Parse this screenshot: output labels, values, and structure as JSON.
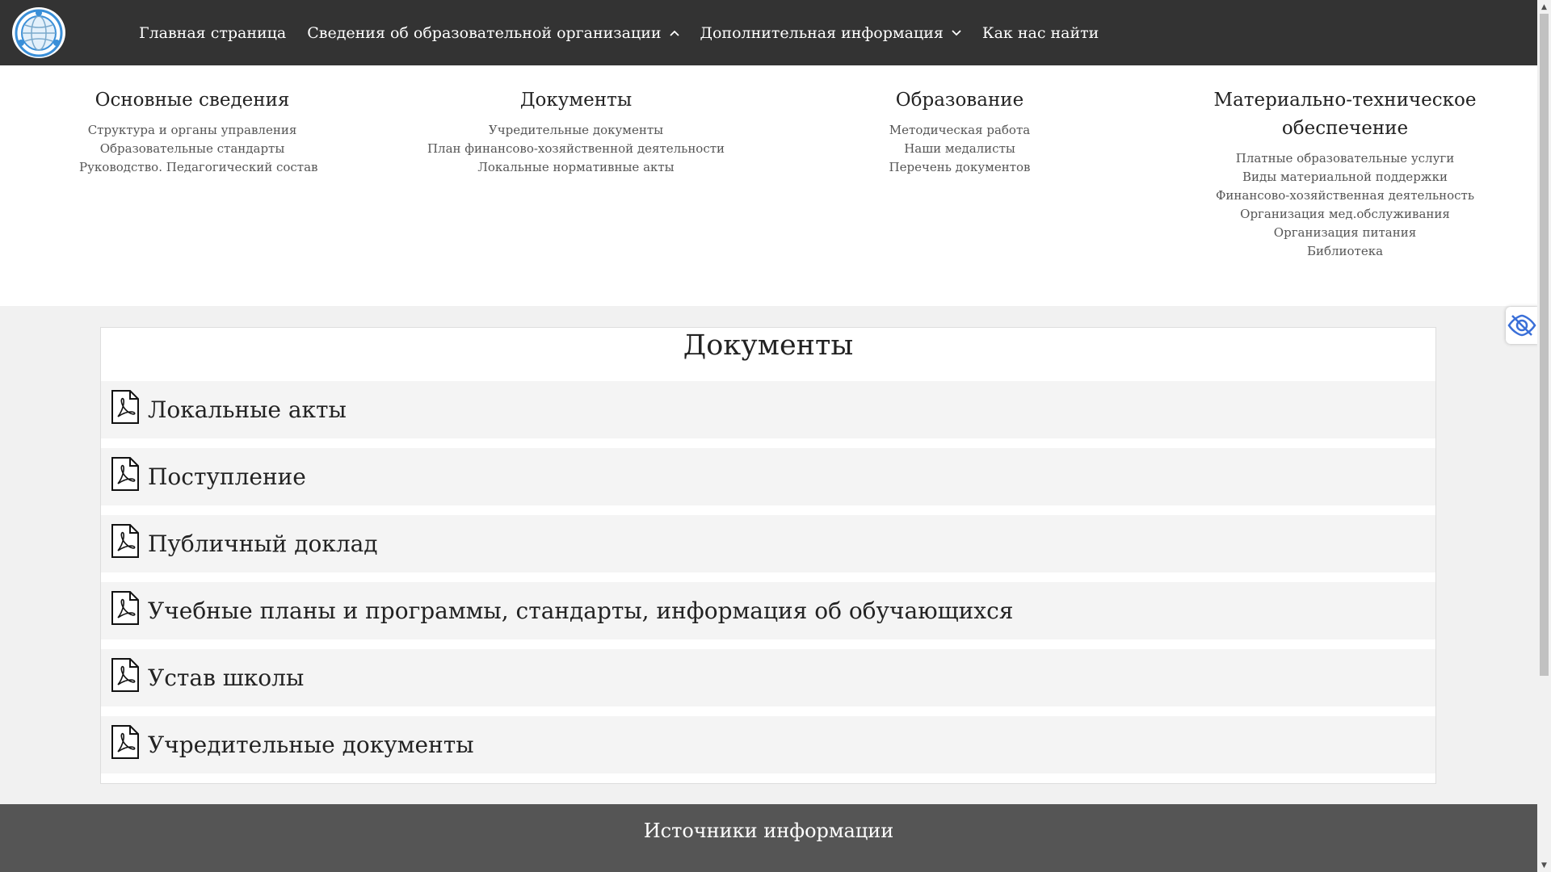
{
  "nav": {
    "items": [
      {
        "label": "Главная страница",
        "has_chevron": false
      },
      {
        "label": "Сведения об образовательной организации",
        "has_chevron": true,
        "chevron": "up"
      },
      {
        "label": "Дополнительная информация",
        "has_chevron": true,
        "chevron": "down"
      },
      {
        "label": "Как нас найти",
        "has_chevron": false
      }
    ],
    "logo_icon": "globe-logo-icon"
  },
  "megamenu": {
    "columns": [
      {
        "title": "Основные сведения",
        "links": [
          "Структура и органы управления",
          "Образовательные стандарты",
          "Руководство. Педагогический состав"
        ]
      },
      {
        "title": "Документы",
        "links": [
          "Учредительные документы",
          "План финансово-хозяйственной деятельности",
          "Локальные нормативные акты"
        ]
      },
      {
        "title": "Образование",
        "links": [
          "Методическая работа",
          "Наши медалисты",
          "Перечень документов"
        ]
      },
      {
        "title_line1": "Материально-техническое",
        "title_line2": "обеспечение",
        "links": [
          "Платные образовательные услуги",
          "Виды материальной поддержки",
          "Финансово-хозяйственная деятельность",
          "Организация мед.обслуживания",
          "Организация питания",
          "Библиотека"
        ]
      }
    ]
  },
  "documents": {
    "title": "Документы",
    "items": [
      {
        "label": "Локальные акты",
        "icon": "pdf-file-icon"
      },
      {
        "label": "Поступление",
        "icon": "pdf-file-icon"
      },
      {
        "label": "Публичный доклад",
        "icon": "pdf-file-icon"
      },
      {
        "label": "Учебные планы и программы, стандарты, информация об обучающихся",
        "icon": "pdf-file-icon"
      },
      {
        "label": "Устав школы",
        "icon": "pdf-file-icon"
      },
      {
        "label": "Учредительные документы",
        "icon": "pdf-file-icon"
      }
    ]
  },
  "footer": {
    "title": "Источники информации"
  },
  "accessibility": {
    "icon": "eye-accessibility-icon"
  },
  "colors": {
    "navbar_bg": "#333333",
    "footer_bg": "#555555",
    "accent": "#3a8fd8"
  }
}
